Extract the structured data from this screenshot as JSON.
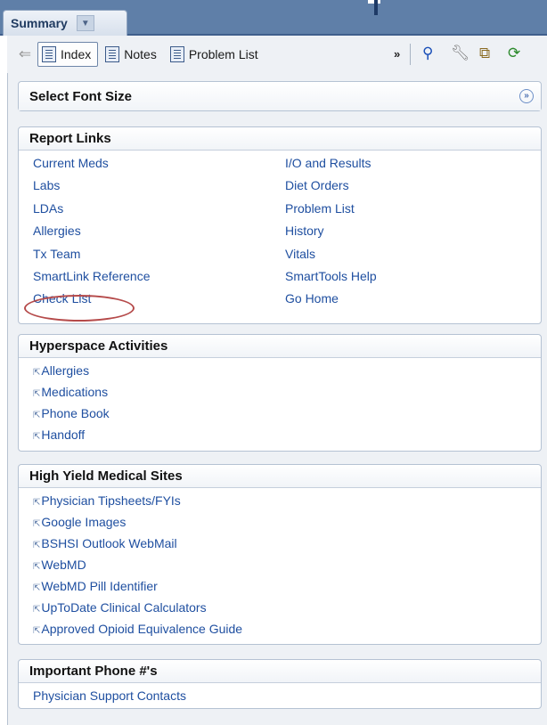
{
  "tab": {
    "label": "Summary"
  },
  "toolbar": {
    "buttons": [
      {
        "label": "Index",
        "active": true
      },
      {
        "label": "Notes",
        "active": false
      },
      {
        "label": "Problem List",
        "active": false
      }
    ],
    "more": "»",
    "icons": [
      "search-icon",
      "wrench-icon",
      "copy-icon",
      "refresh-icon"
    ]
  },
  "font_panel": {
    "title": "Select Font Size",
    "collapse_glyph": "»"
  },
  "report_links": {
    "title": "Report Links",
    "items": [
      "Current Meds",
      "I/O and Results",
      "Labs",
      "Diet Orders",
      "LDAs",
      "Problem List",
      "Allergies",
      "History",
      "Tx Team",
      "Vitals",
      "SmartLink Reference",
      "SmartTools Help",
      "Check List",
      "Go Home"
    ]
  },
  "hyperspace": {
    "title": "Hyperspace Activities",
    "items": [
      "Allergies",
      "Medications",
      "Phone Book",
      "Handoff"
    ]
  },
  "high_yield": {
    "title": "High Yield Medical Sites",
    "items": [
      "Physician Tipsheets/FYIs",
      "Google Images",
      "BSHSI Outlook WebMail",
      "WebMD",
      "WebMD Pill Identifier",
      "UpToDate Clinical Calculators",
      "Approved Opioid Equivalence Guide"
    ]
  },
  "phone": {
    "title": "Important Phone #'s",
    "items": [
      "Physician Support Contacts"
    ]
  },
  "colors": {
    "link": "#1f4fa0",
    "header_bar": "#5f7fa8",
    "highlight_circle": "#b54a4a"
  }
}
